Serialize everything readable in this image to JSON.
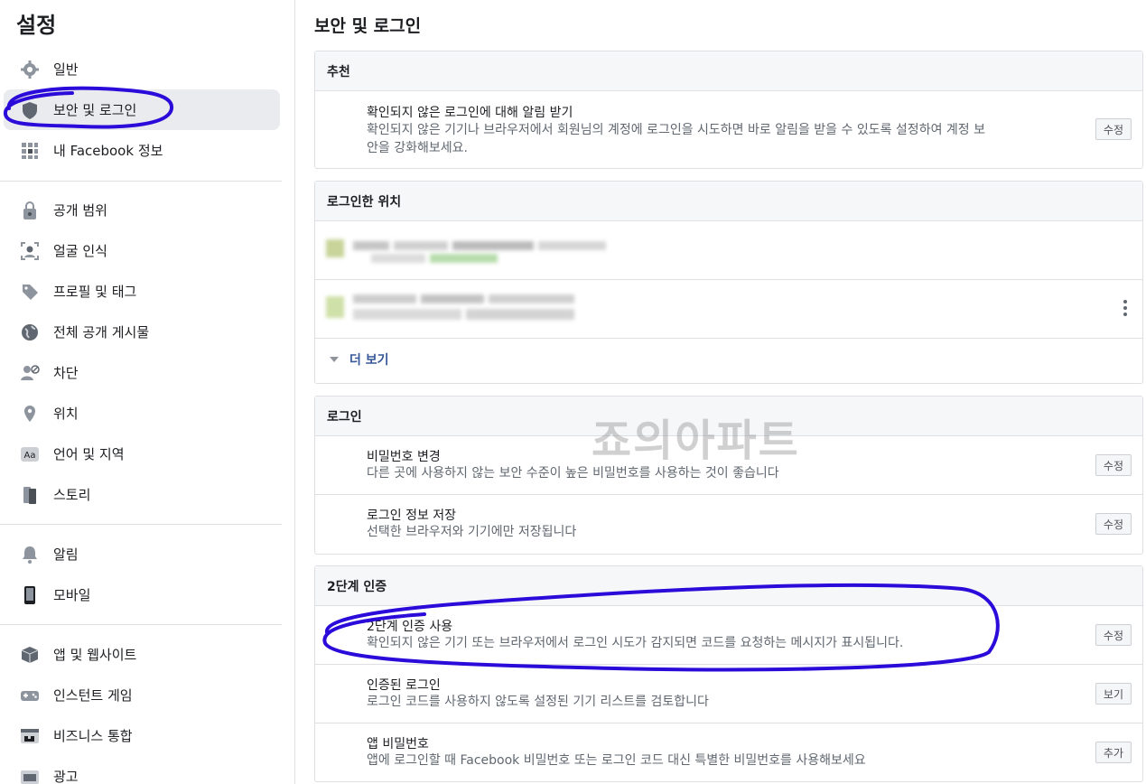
{
  "sidebar": {
    "title": "설정",
    "groups": [
      [
        {
          "label": "일반",
          "icon": "gear-icon"
        },
        {
          "label": "보안 및 로그인",
          "icon": "shield-icon",
          "active": true
        },
        {
          "label": "내 Facebook 정보",
          "icon": "grid-icon"
        }
      ],
      [
        {
          "label": "공개 범위",
          "icon": "lock-icon"
        },
        {
          "label": "얼굴 인식",
          "icon": "face-icon"
        },
        {
          "label": "프로필 및 태그",
          "icon": "tag-icon"
        },
        {
          "label": "전체 공개 게시물",
          "icon": "globe-icon"
        },
        {
          "label": "차단",
          "icon": "block-user-icon"
        },
        {
          "label": "위치",
          "icon": "location-icon"
        },
        {
          "label": "언어 및 지역",
          "icon": "language-icon"
        },
        {
          "label": "스토리",
          "icon": "story-icon"
        }
      ],
      [
        {
          "label": "알림",
          "icon": "bell-icon"
        },
        {
          "label": "모바일",
          "icon": "mobile-icon"
        }
      ],
      [
        {
          "label": "앱 및 웹사이트",
          "icon": "box-icon"
        },
        {
          "label": "인스턴트 게임",
          "icon": "game-icon"
        },
        {
          "label": "비즈니스 통합",
          "icon": "business-icon"
        },
        {
          "label": "광고",
          "icon": "ads-icon"
        }
      ]
    ]
  },
  "main": {
    "title": "보안 및 로그인",
    "recommended": {
      "header": "추천",
      "rows": [
        {
          "title": "확인되지 않은 로그인에 대해 알림 받기",
          "desc_line1": "확인되지 않은 기기나 브라우저에서 회원님의 계정에 로그인을 시도하면 바로 알림을 받을 수 있도록 설정하여 계정 보",
          "desc_line2": "안을 강화해보세요.",
          "button": "수정"
        }
      ]
    },
    "where_logged_in": {
      "header": "로그인한 위치",
      "more_label": "더 보기"
    },
    "login": {
      "header": "로그인",
      "rows": [
        {
          "title": "비밀번호 변경",
          "desc": "다른 곳에 사용하지 않는 보안 수준이 높은 비밀번호를 사용하는 것이 좋습니다",
          "button": "수정"
        },
        {
          "title": "로그인 정보 저장",
          "desc": "선택한 브라우저와 기기에만 저장됩니다",
          "button": "수정"
        }
      ]
    },
    "two_factor": {
      "header": "2단계 인증",
      "rows": [
        {
          "title": "2단계 인증 사용",
          "desc": "확인되지 않은 기기 또는 브라우저에서 로그인 시도가 감지되면 코드를 요청하는 메시지가 표시됩니다.",
          "button": "수정"
        },
        {
          "title": "인증된 로그인",
          "desc": "로그인 코드를 사용하지 않도록 설정된 기기 리스트를 검토합니다",
          "button": "보기"
        },
        {
          "title": "앱 비밀번호",
          "desc": "앱에 로그인할 때 Facebook 비밀번호 또는 로그인 코드 대신 특별한 비밀번호를 사용해보세요",
          "button": "추가"
        }
      ]
    }
  },
  "watermark": "죠의아파트",
  "colors": {
    "annotation": "#2b0bd9",
    "link": "#365899",
    "header_bg": "#f6f7f9",
    "active_bg": "#e9ebee"
  }
}
